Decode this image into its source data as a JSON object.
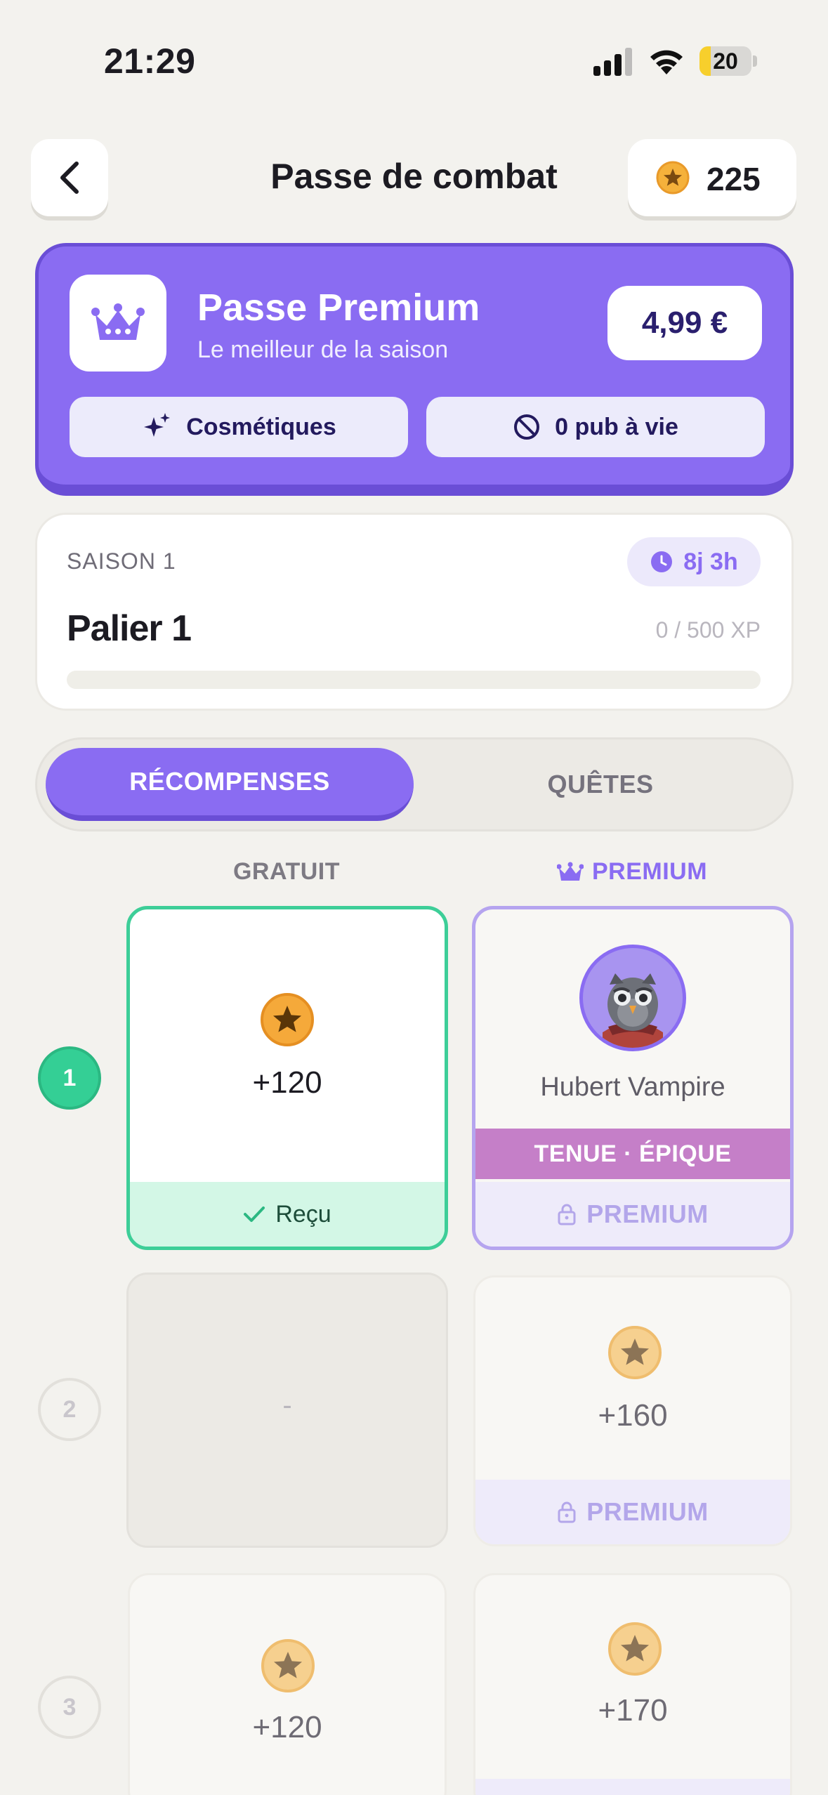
{
  "status_bar": {
    "time": "21:29",
    "battery": "20"
  },
  "header": {
    "title": "Passe de combat",
    "coins": "225"
  },
  "premium": {
    "title": "Passe Premium",
    "subtitle": "Le meilleur de la saison",
    "price": "4,99 €",
    "features": [
      "Cosmétiques",
      "0 pub à vie"
    ]
  },
  "season": {
    "label": "SAISON 1",
    "timer": "8j 3h",
    "tier_title": "Palier 1",
    "xp": "0 / 500 XP",
    "xp_progress": 0
  },
  "tabs": {
    "active": "RÉCOMPENSES",
    "inactive": "QUÊTES"
  },
  "columns": {
    "free": "GRATUIT",
    "premium": "PREMIUM"
  },
  "tiers": [
    {
      "number": "1",
      "free": {
        "amount": "+120",
        "status": "Reçu"
      },
      "premium": {
        "name": "Hubert Vampire",
        "rarity": "TENUE · ÉPIQUE",
        "lock_label": "PREMIUM"
      }
    },
    {
      "number": "2",
      "free": {
        "empty": "-"
      },
      "premium": {
        "amount": "+160",
        "lock_label": "PREMIUM"
      }
    },
    {
      "number": "3",
      "free": {
        "amount": "+120"
      },
      "premium": {
        "amount": "+170"
      }
    }
  ],
  "colors": {
    "accent": "#8a6cf2",
    "accent_dark": "#6a4ed6",
    "success": "#34cf95",
    "epic": "#c57fc8",
    "background": "#f3f2ee"
  }
}
